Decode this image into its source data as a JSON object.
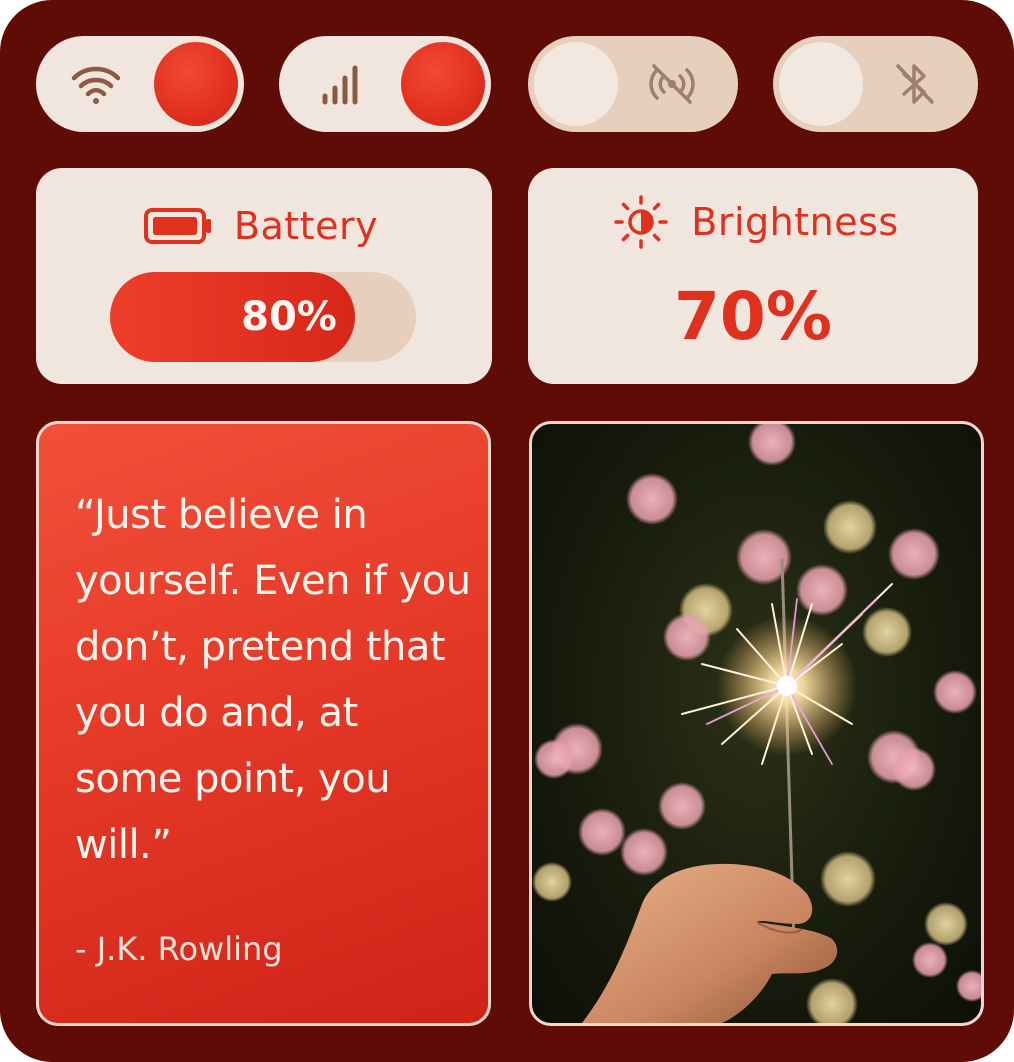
{
  "toggles": [
    {
      "id": "wifi",
      "icon": "wifi-icon",
      "state": "on"
    },
    {
      "id": "cellular",
      "icon": "signal-bars-icon",
      "state": "on"
    },
    {
      "id": "nfc",
      "icon": "nfc-off-icon",
      "state": "off"
    },
    {
      "id": "bluetooth",
      "icon": "bluetooth-off-icon",
      "state": "off"
    }
  ],
  "battery": {
    "title": "Battery",
    "value_label": "80%",
    "level": 0.8,
    "icon": "battery-icon"
  },
  "brightness": {
    "title": "Brightness",
    "value_label": "70%",
    "icon": "brightness-sun-icon"
  },
  "quote": {
    "text": "“Just believe in yourself. Even if you don’t, pretend that you do and, at some point, you will.”",
    "author": "- J.K. Rowling"
  },
  "photo": {
    "subject": "sparkler-bokeh-photo"
  },
  "colors": {
    "background": "#5e0c05",
    "card": "#f1e6de",
    "accent": "#e0301e",
    "track": "#e6cfbd",
    "icon_muted": "#8a5a44"
  }
}
